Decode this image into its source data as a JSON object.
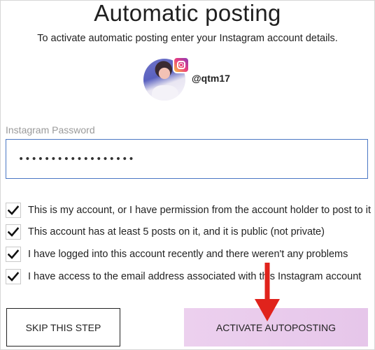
{
  "header": {
    "title": "Automatic posting",
    "subtitle": "To activate automatic posting enter your Instagram account details."
  },
  "account": {
    "username": "@qtm17"
  },
  "password": {
    "label": "Instagram Password",
    "value": "••••••••••••••••••"
  },
  "confirmations": [
    {
      "label": "This is my account, or I have permission from the account holder to post to it",
      "checked": true
    },
    {
      "label": "This account has at least 5 posts on it, and it is public (not private)",
      "checked": true
    },
    {
      "label": "I have logged into this account recently and there weren't any problems",
      "checked": true
    },
    {
      "label": "I have access to the email address associated with this Instagram account",
      "checked": true
    }
  ],
  "buttons": {
    "skip": "SKIP THIS STEP",
    "activate": "ACTIVATE AUTOPOSTING"
  },
  "colors": {
    "accent_border": "#4a77c4",
    "activate_bg": "#e6c6ea",
    "annotation_arrow": "#e0231c",
    "instagram_gradient": [
      "#f9c23c",
      "#ea3f7e",
      "#8a3ab9"
    ]
  },
  "icons": [
    "instagram-badge-icon",
    "checkmark-icon",
    "red-arrow-annotation-icon"
  ]
}
